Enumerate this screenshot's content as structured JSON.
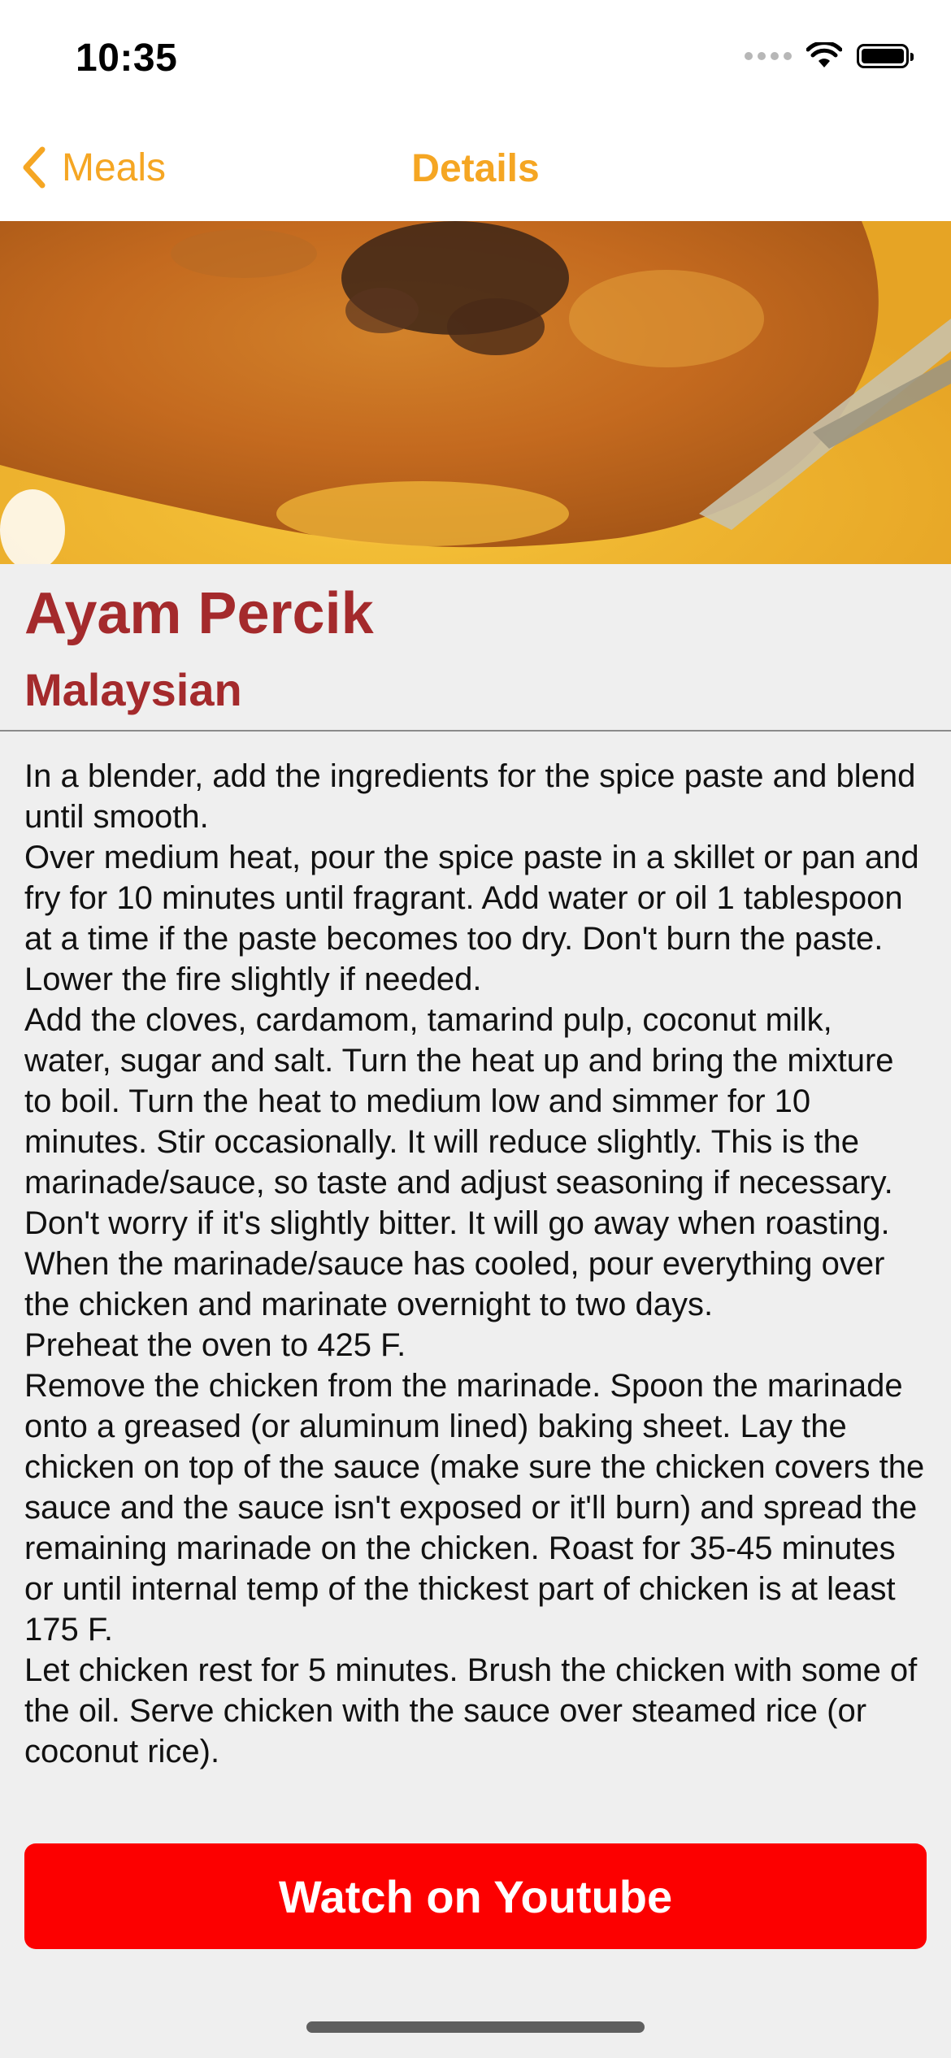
{
  "status_bar": {
    "time": "10:35"
  },
  "nav": {
    "back_label": "Meals",
    "title": "Details",
    "accent_color": "#f5a623"
  },
  "hero": {
    "image": "fried-chicken-food-photo"
  },
  "meal": {
    "name": "Ayam Percik",
    "area": "Malaysian",
    "title_color": "#a42a2c",
    "instructions": "In a blender, add the ingredients for the spice paste and blend until smooth.\nOver medium heat, pour the spice paste in a skillet or pan and fry for 10 minutes until fragrant. Add water or oil 1 tablespoon at a time if the paste becomes too dry. Don't burn the paste. Lower the fire slightly if needed.\nAdd the cloves, cardamom, tamarind pulp, coconut milk, water, sugar and salt. Turn the heat up and bring the mixture to boil. Turn the heat to medium low and simmer for 10 minutes. Stir occasionally. It will reduce slightly. This is the marinade/sauce, so taste and adjust seasoning if necessary. Don't worry if it's slightly bitter. It will go away when roasting.\nWhen the marinade/sauce has cooled, pour everything over the chicken and marinate overnight to two days.\nPreheat the oven to 425 F.\nRemove the chicken from the marinade. Spoon the marinade onto a greased (or aluminum lined) baking sheet. Lay the chicken on top of the sauce (make sure the chicken covers the sauce and the sauce isn't exposed or it'll burn) and spread the remaining marinade on the chicken. Roast for 35-45 minutes or until internal temp of the thickest part of chicken is at least 175 F.\nLet chicken rest for 5 minutes. Brush the chicken with some of the oil. Serve chicken with the sauce over steamed rice (or coconut rice)."
  },
  "actions": {
    "youtube_label": "Watch on Youtube",
    "youtube_color": "#fc0000"
  },
  "icons": {
    "back": "chevron-left-icon",
    "signal": "cellular-signal-icon",
    "wifi": "wifi-icon",
    "battery": "battery-icon"
  }
}
